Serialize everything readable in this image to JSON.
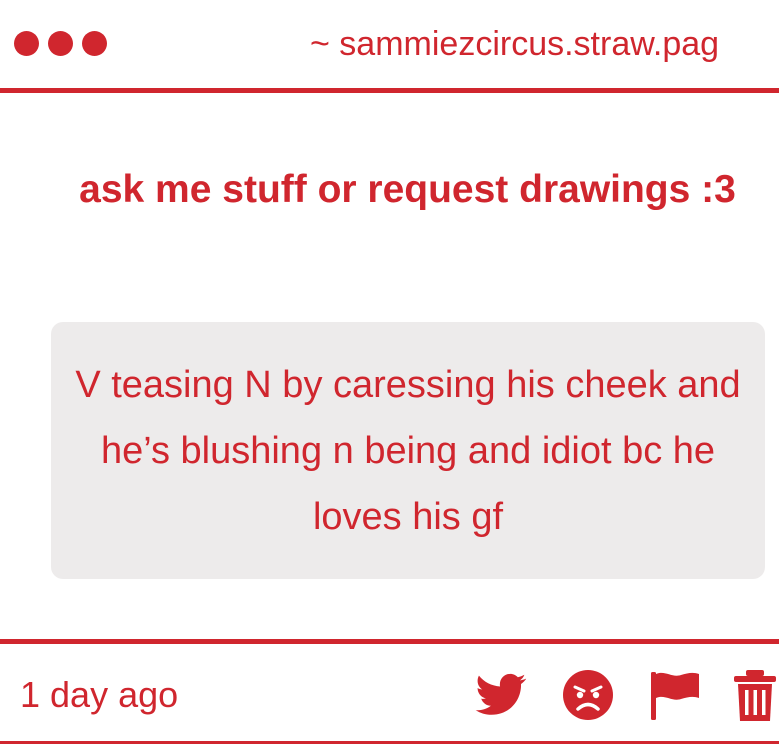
{
  "header": {
    "url": "~ sammiezcircus.straw.pag"
  },
  "page": {
    "title": "ask me stuff or request drawings :3"
  },
  "question": {
    "text": "V teasing N by caressing his cheek and he’s blushing n being and idiot bc he loves his gf"
  },
  "footer": {
    "timestamp": "1 day ago",
    "icons": [
      "twitter-icon",
      "angry-face-icon",
      "flag-icon",
      "trash-icon"
    ]
  },
  "colors": {
    "accent": "#d0262e",
    "question_background": "#edebeb",
    "page_background": "#ffffff"
  }
}
